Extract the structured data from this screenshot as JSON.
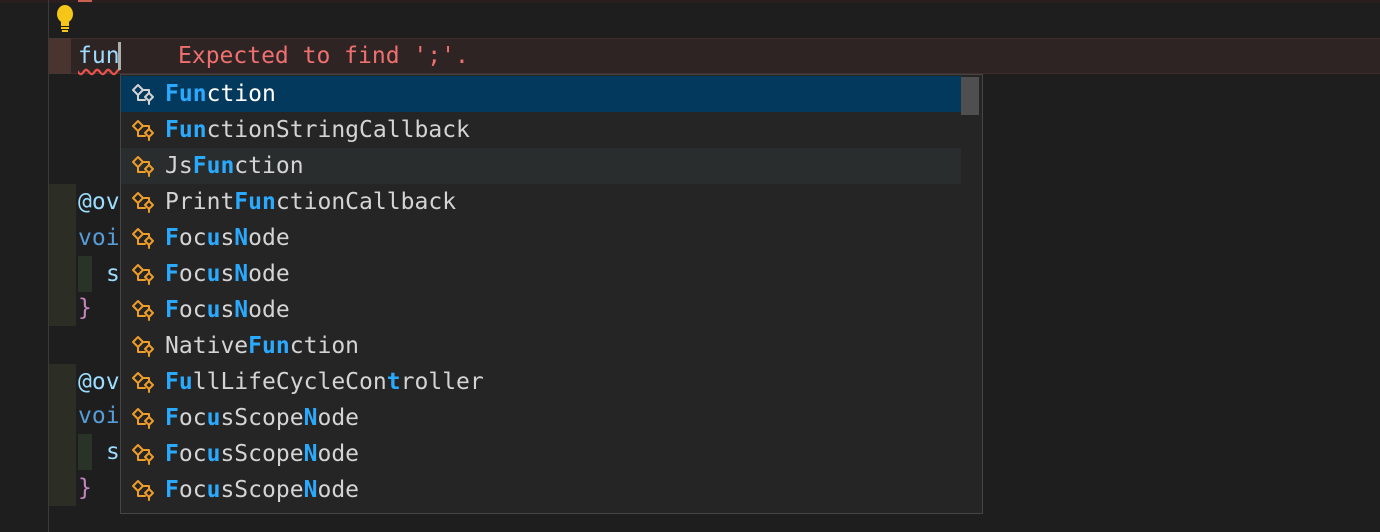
{
  "editor": {
    "typed_text": "fun",
    "diagnostic": "Expected to find ';'.",
    "code_fragments": {
      "annotation_1": "@ov",
      "keyword_1": "voi",
      "stmt_1": "s",
      "brace_1": "}",
      "annotation_2": "@ov",
      "keyword_2": "voi",
      "stmt_2": "s",
      "brace_2": "}"
    }
  },
  "suggestions": [
    {
      "label": "Function",
      "match": [
        0,
        1,
        2
      ],
      "state": "selected",
      "icon": "class-icon"
    },
    {
      "label": "FunctionStringCallback",
      "match": [
        0,
        1,
        2
      ],
      "state": "normal",
      "icon": "class-icon"
    },
    {
      "label": "JsFunction",
      "match": [
        2,
        3,
        4
      ],
      "state": "hovered",
      "icon": "class-icon"
    },
    {
      "label": "PrintFunctionCallback",
      "match": [
        5,
        6,
        7
      ],
      "state": "normal",
      "icon": "class-icon"
    },
    {
      "label": "FocusNode",
      "match": [
        0,
        3,
        5
      ],
      "state": "normal",
      "icon": "class-icon"
    },
    {
      "label": "FocusNode",
      "match": [
        0,
        3,
        5
      ],
      "state": "normal",
      "icon": "class-icon"
    },
    {
      "label": "FocusNode",
      "match": [
        0,
        3,
        5
      ],
      "state": "normal",
      "icon": "class-icon"
    },
    {
      "label": "NativeFunction",
      "match": [
        6,
        7,
        8
      ],
      "state": "normal",
      "icon": "class-icon"
    },
    {
      "label": "FullLifeCycleController",
      "match": [
        0,
        1,
        16
      ],
      "state": "normal",
      "icon": "class-icon"
    },
    {
      "label": "FocusScopeNode",
      "match": [
        0,
        3,
        10
      ],
      "state": "normal",
      "icon": "class-icon"
    },
    {
      "label": "FocusScopeNode",
      "match": [
        0,
        3,
        10
      ],
      "state": "normal",
      "icon": "class-icon"
    },
    {
      "label": "FocusScopeNode",
      "match": [
        0,
        3,
        10
      ],
      "state": "normal",
      "icon": "class-icon"
    }
  ],
  "colors": {
    "selected_bg": "#04395e",
    "match_highlight": "#2aaaff",
    "icon_orange": "#ee9d28",
    "error_text": "#f07070"
  }
}
